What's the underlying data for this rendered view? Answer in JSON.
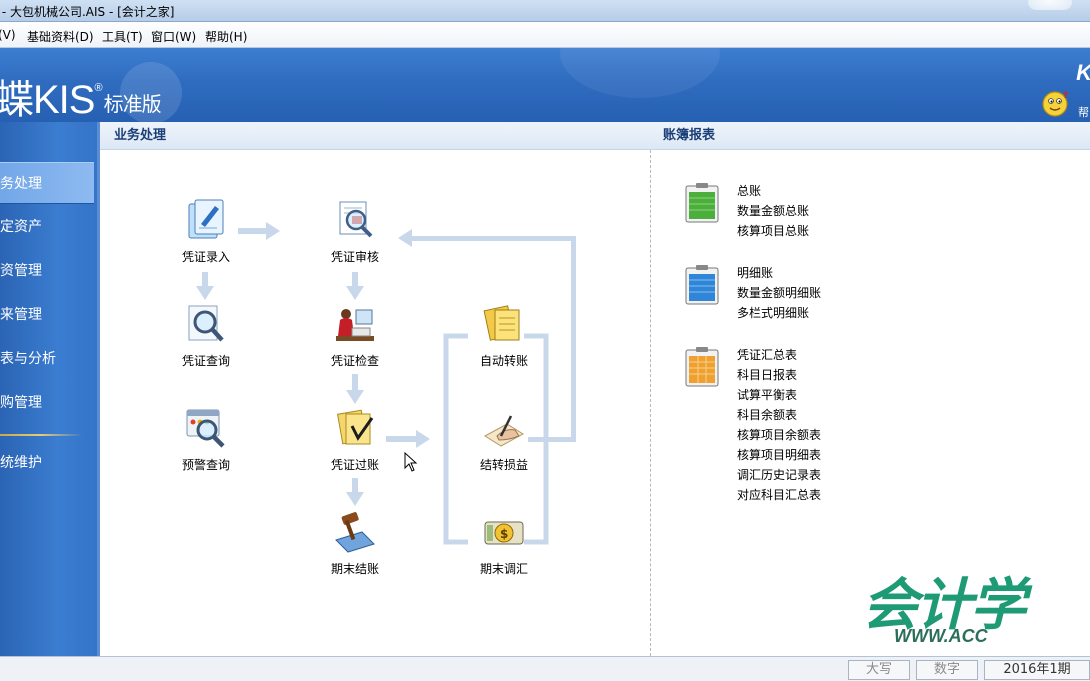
{
  "window": {
    "title": "版 - 大包机械公司.AIS - [会计之家]"
  },
  "menu": [
    {
      "label": "(V)"
    },
    {
      "label": "基础资料(D)"
    },
    {
      "label": "工具(T)"
    },
    {
      "label": "窗口(W)"
    },
    {
      "label": "帮助(H)"
    }
  ],
  "banner": {
    "logo_main": "蝶KIS",
    "logo_reg": "®",
    "logo_sub": "标准版",
    "brand_right": "K",
    "help_label": "帮"
  },
  "sidebar": {
    "items": [
      {
        "label": "务处理",
        "active": true
      },
      {
        "label": "定资产"
      },
      {
        "label": "资管理"
      },
      {
        "label": "来管理"
      },
      {
        "label": "表与分析"
      },
      {
        "label": "购管理"
      },
      {
        "label": "统维护"
      }
    ]
  },
  "business": {
    "header": "业务处理",
    "nodes": {
      "voucher_entry": {
        "label": "凭证录入",
        "icon": "voucher-entry-icon"
      },
      "voucher_review": {
        "label": "凭证审核",
        "icon": "voucher-review-icon"
      },
      "voucher_query": {
        "label": "凭证查询",
        "icon": "voucher-query-icon"
      },
      "voucher_check": {
        "label": "凭证检查",
        "icon": "voucher-check-icon"
      },
      "alert_query": {
        "label": "预警查询",
        "icon": "alert-query-icon"
      },
      "voucher_post": {
        "label": "凭证过账",
        "icon": "voucher-post-icon"
      },
      "period_close": {
        "label": "期末结账",
        "icon": "period-close-icon"
      },
      "auto_transfer": {
        "label": "自动转账",
        "icon": "auto-transfer-icon"
      },
      "pl_transfer": {
        "label": "结转损益",
        "icon": "pl-transfer-icon"
      },
      "fx_adjust": {
        "label": "期末调汇",
        "icon": "fx-adjust-icon"
      }
    }
  },
  "reports": {
    "header": "账簿报表",
    "groups": [
      {
        "icon": "general-ledger-icon",
        "color": "#4caf3c",
        "links": [
          "总账",
          "数量金额总账",
          "核算项目总账"
        ]
      },
      {
        "icon": "detail-ledger-icon",
        "color": "#2f86d8",
        "links": [
          "明细账",
          "数量金额明细账",
          "多栏式明细账"
        ]
      },
      {
        "icon": "summary-report-icon",
        "color": "#f0a030",
        "links": [
          "凭证汇总表",
          "科目日报表",
          "试算平衡表",
          "科目余额表",
          "核算项目余额表",
          "核算项目明细表",
          "调汇历史记录表",
          "对应科目汇总表"
        ]
      }
    ]
  },
  "watermark": {
    "text": "会计学",
    "url": "WWW.ACC"
  },
  "status": {
    "caps": "大写",
    "num": "数字",
    "period": "2016年1期"
  },
  "colors": {
    "banner": "#2f6cc0",
    "sidebar": "#3574c8",
    "header_text": "#1a3f78",
    "watermark": "#1e9a75"
  }
}
